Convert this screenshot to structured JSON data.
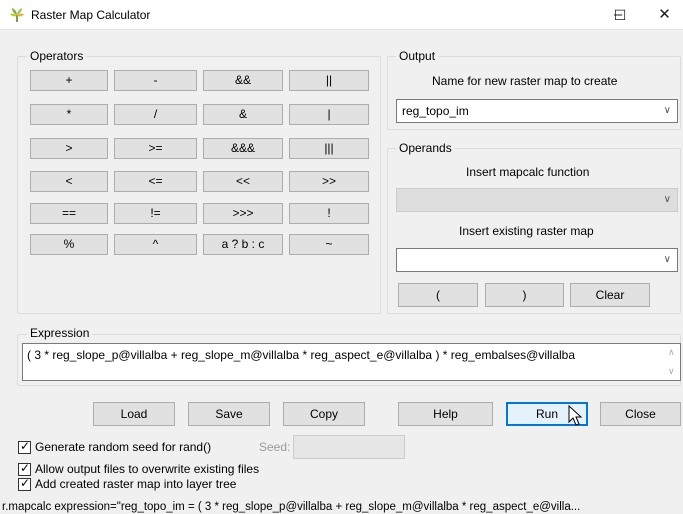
{
  "window": {
    "title": "Raster Map Calculator",
    "controls": {
      "minimize": "–",
      "maximize": "☐",
      "close": "✕"
    }
  },
  "operators": {
    "label": "Operators",
    "rows": [
      [
        "+",
        "-",
        "&&",
        "||"
      ],
      [
        "*",
        "/",
        "&",
        "|"
      ],
      [
        ">",
        ">=",
        "&&&",
        "|||"
      ],
      [
        "<",
        "<=",
        "<<",
        ">>"
      ],
      [
        "==",
        "!=",
        ">>>",
        "!"
      ],
      [
        "%",
        "^",
        "a ? b : c",
        "~"
      ]
    ]
  },
  "output": {
    "label": "Output",
    "name_label": "Name for new raster map to create",
    "name_value": "reg_topo_im"
  },
  "operands": {
    "label": "Operands",
    "function_label": "Insert mapcalc function",
    "function_value": "",
    "raster_label": "Insert existing raster map",
    "raster_value": "",
    "open_paren": "(",
    "close_paren": ")",
    "clear": "Clear"
  },
  "expression": {
    "label": "Expression",
    "value": "( 3 * reg_slope_p@villalba + reg_slope_m@villalba * reg_aspect_e@villalba ) * reg_embalses@villalba"
  },
  "buttons": {
    "load": "Load",
    "save": "Save",
    "copy": "Copy",
    "help": "Help",
    "run": "Run",
    "close": "Close"
  },
  "options": {
    "seed_checkbox": "Generate random seed for rand()",
    "seed_label": "Seed:",
    "seed_value": "",
    "overwrite_checkbox": "Allow output files to overwrite existing files",
    "add_layer_checkbox": "Add created raster map into layer tree"
  },
  "status": "r.mapcalc expression=\"reg_topo_im = ( 3 * reg_slope_p@villalba + reg_slope_m@villalba * reg_aspect_e@villa..."
}
